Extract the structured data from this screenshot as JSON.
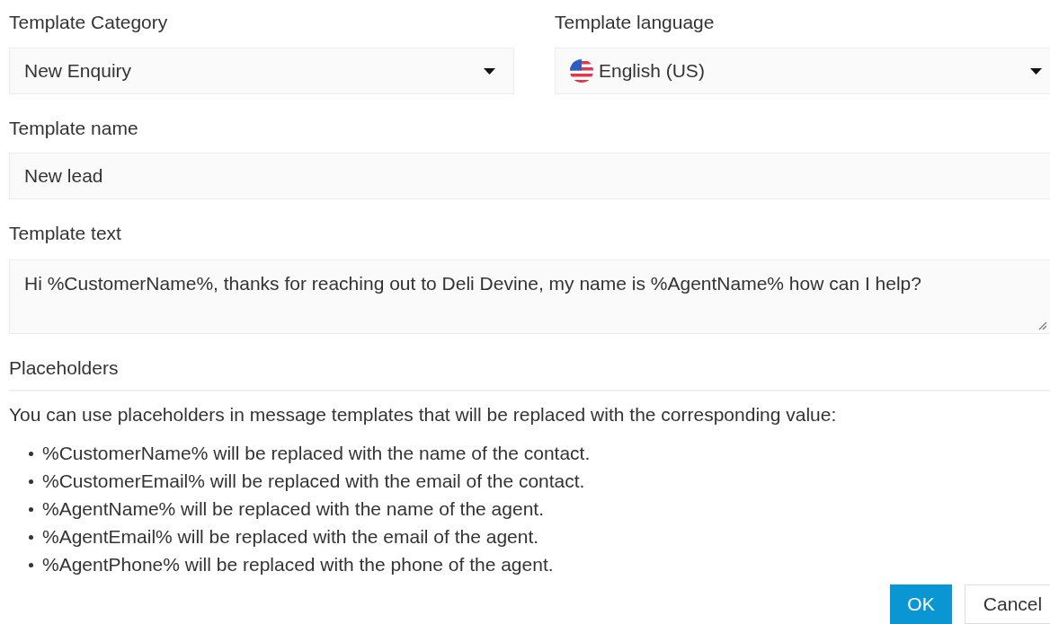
{
  "category": {
    "label": "Template Category",
    "value": "New Enquiry"
  },
  "language": {
    "label": "Template language",
    "value": "English (US)"
  },
  "name": {
    "label": "Template name",
    "value": "New lead"
  },
  "text": {
    "label": "Template text",
    "value": "Hi %CustomerName%, thanks for reaching out to Deli Devine, my name is %AgentName% how can I help?"
  },
  "placeholders": {
    "heading": "Placeholders",
    "intro": "You can use placeholders in message templates that will be replaced with the corresponding value:",
    "items": [
      "%CustomerName% will be replaced with the name of the contact.",
      "%CustomerEmail% will be replaced with the email of the contact.",
      "%AgentName% will be replaced with the name of the agent.",
      "%AgentEmail% will be replaced with the email of the agent.",
      "%AgentPhone% will be replaced with the phone of the agent."
    ]
  },
  "buttons": [
    {
      "label": "OK",
      "kind": "primary"
    },
    {
      "label": "Cancel",
      "kind": "secondary"
    }
  ]
}
